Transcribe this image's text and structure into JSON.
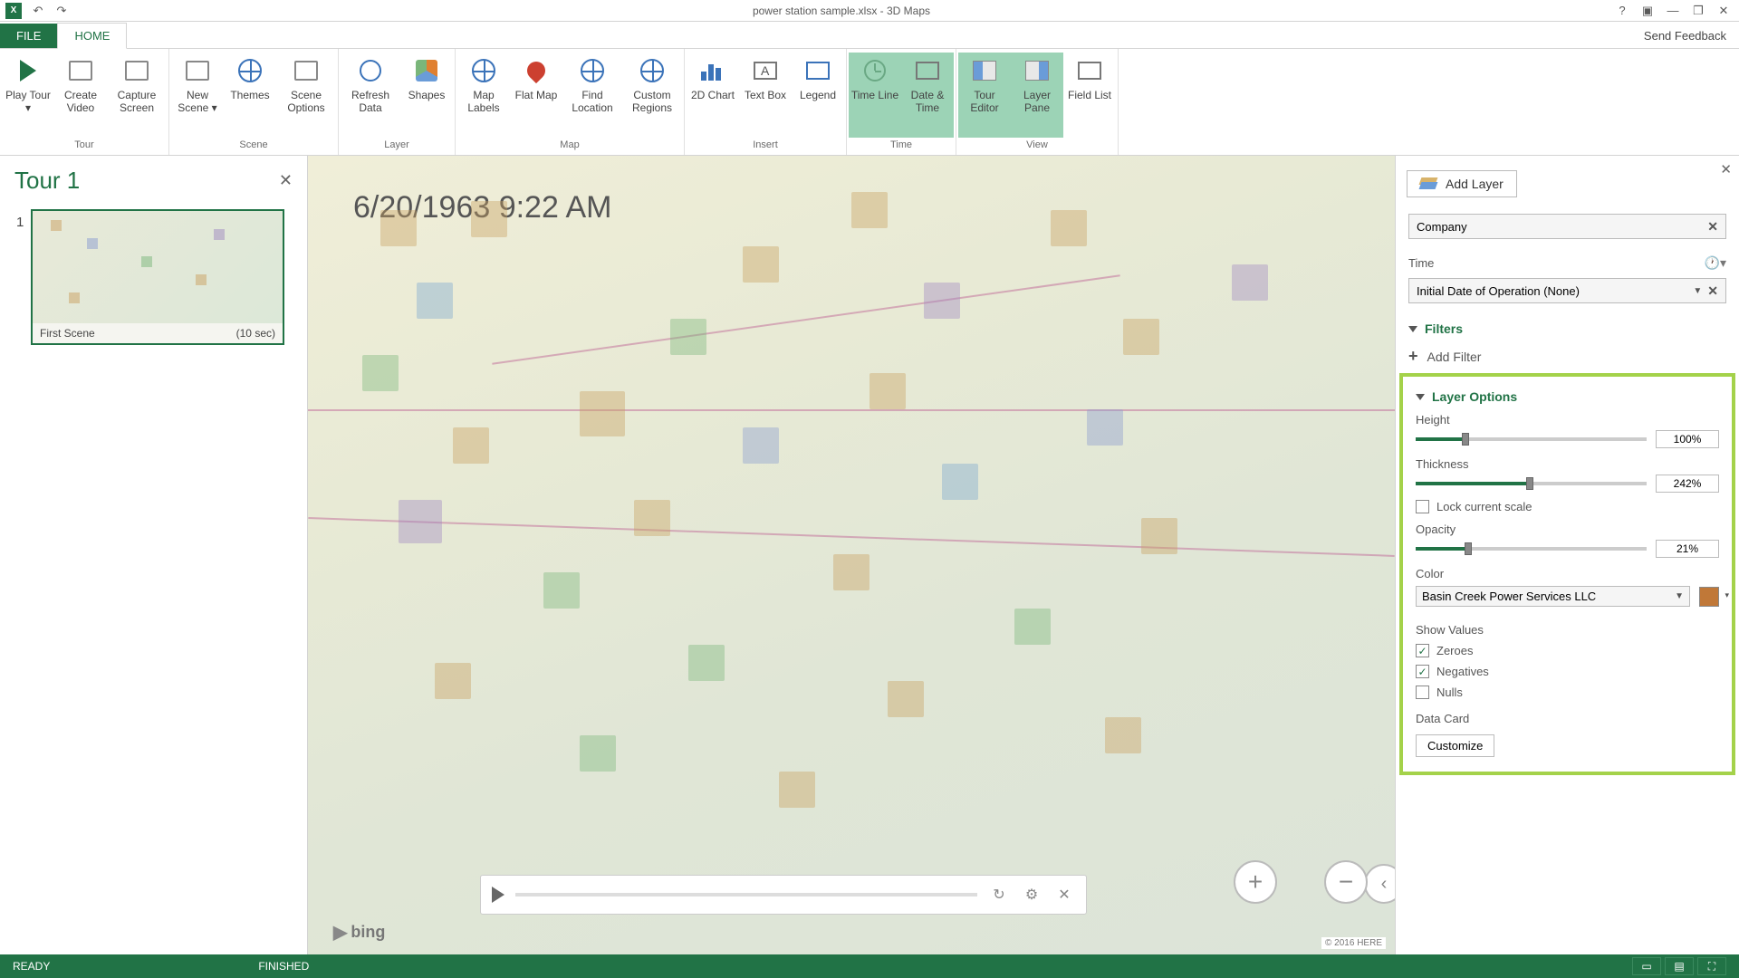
{
  "titlebar": {
    "title": "power station sample.xlsx - 3D Maps"
  },
  "tabs": {
    "file": "FILE",
    "home": "HOME",
    "feedback": "Send Feedback"
  },
  "ribbon": {
    "tour": {
      "label": "Tour",
      "play": "Play Tour ▾",
      "create": "Create Video",
      "capture": "Capture Screen"
    },
    "scene": {
      "label": "Scene",
      "new": "New Scene ▾",
      "themes": "Themes",
      "options": "Scene Options"
    },
    "layer": {
      "label": "Layer",
      "refresh": "Refresh Data",
      "shapes": "Shapes"
    },
    "map": {
      "label": "Map",
      "labels": "Map Labels",
      "flat": "Flat Map",
      "find": "Find Location",
      "custom": "Custom Regions"
    },
    "insert": {
      "label": "Insert",
      "chart": "2D Chart",
      "text": "Text Box",
      "legend": "Legend"
    },
    "time": {
      "label": "Time",
      "timeline": "Time Line",
      "datetime": "Date & Time"
    },
    "view": {
      "label": "View",
      "editor": "Tour Editor",
      "layerpane": "Layer Pane",
      "fieldlist": "Field List"
    }
  },
  "tourpanel": {
    "title": "Tour 1",
    "scene_num": "1",
    "scene_name": "First Scene",
    "scene_duration": "(10 sec)"
  },
  "map": {
    "timestamp": "6/20/1963 9:22 AM",
    "copyright": "© 2016 HERE",
    "bing": "bing"
  },
  "layerpanel": {
    "add_layer": "Add Layer",
    "company": "Company",
    "time_label": "Time",
    "time_field": "Initial Date of Operation (None)",
    "filters": "Filters",
    "add_filter": "Add Filter",
    "layer_options": "Layer Options",
    "height": {
      "label": "Height",
      "value": "100%"
    },
    "thickness": {
      "label": "Thickness",
      "value": "242%"
    },
    "lock_scale": "Lock current scale",
    "opacity": {
      "label": "Opacity",
      "value": "21%"
    },
    "color_label": "Color",
    "color_field": "Basin Creek Power Services LLC",
    "show_values": "Show Values",
    "zeroes": "Zeroes",
    "negatives": "Negatives",
    "nulls": "Nulls",
    "data_card": "Data Card",
    "customize": "Customize"
  },
  "statusbar": {
    "ready": "READY",
    "finished": "FINISHED"
  }
}
